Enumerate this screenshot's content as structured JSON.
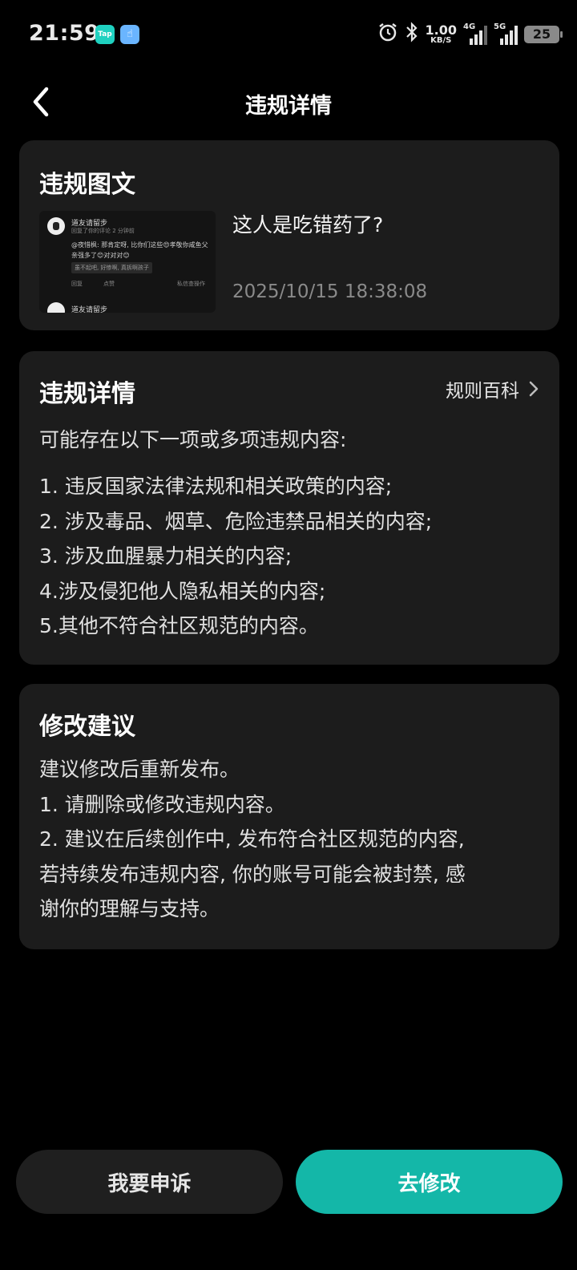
{
  "status_bar": {
    "time": "21:59",
    "tap_icon_text": "Tap",
    "net_speed": "1.00",
    "net_speed_unit": "KB/S",
    "sim1_label": "4G",
    "sim2_label": "5G",
    "battery": "25"
  },
  "header": {
    "title": "违规详情"
  },
  "violation_post": {
    "title": "违规图文",
    "text": "这人是吃错药了?",
    "timestamp": "2025/10/15 18:38:08",
    "thumbnail": {
      "author": "道友请留步",
      "subtitle": "回复了你的评论 2 分钟前",
      "comment": "@夜惜枫: 那肯定呀, 比你们这些😍孝敬你咸鱼父亲强多了😊对对对😊",
      "quote": "虽不起吧, 好惨啊, 真拆啊孩子",
      "reply": "回复",
      "like": "点赞",
      "private": "私信查操作",
      "next_author": "道友请留步"
    }
  },
  "violation_details": {
    "title": "违规详情",
    "rule_link": "规则百科",
    "intro": "可能存在以下一项或多项违规内容:",
    "items": [
      "1. 违反国家法律法规和相关政策的内容;",
      "2. 涉及毒品、烟草、危险违禁品相关的内容;",
      "3. 涉及血腥暴力相关的内容;",
      "4.涉及侵犯他人隐私相关的内容;",
      "5.其他不符合社区规范的内容。"
    ]
  },
  "suggestions": {
    "title": "修改建议",
    "lines": [
      "建议修改后重新发布。",
      "1. 请删除或修改违规内容。",
      "2. 建议在后续创作中, 发布符合社区规范的内容,",
      "若持续发布违规内容, 你的账号可能会被封禁, 感",
      "谢你的理解与支持。"
    ]
  },
  "buttons": {
    "appeal": "我要申诉",
    "edit": "去修改"
  },
  "colors": {
    "background": "#000000",
    "card": "#1c1c1c",
    "accent": "#14b7a8",
    "secondary_button": "#1f1f1f"
  }
}
